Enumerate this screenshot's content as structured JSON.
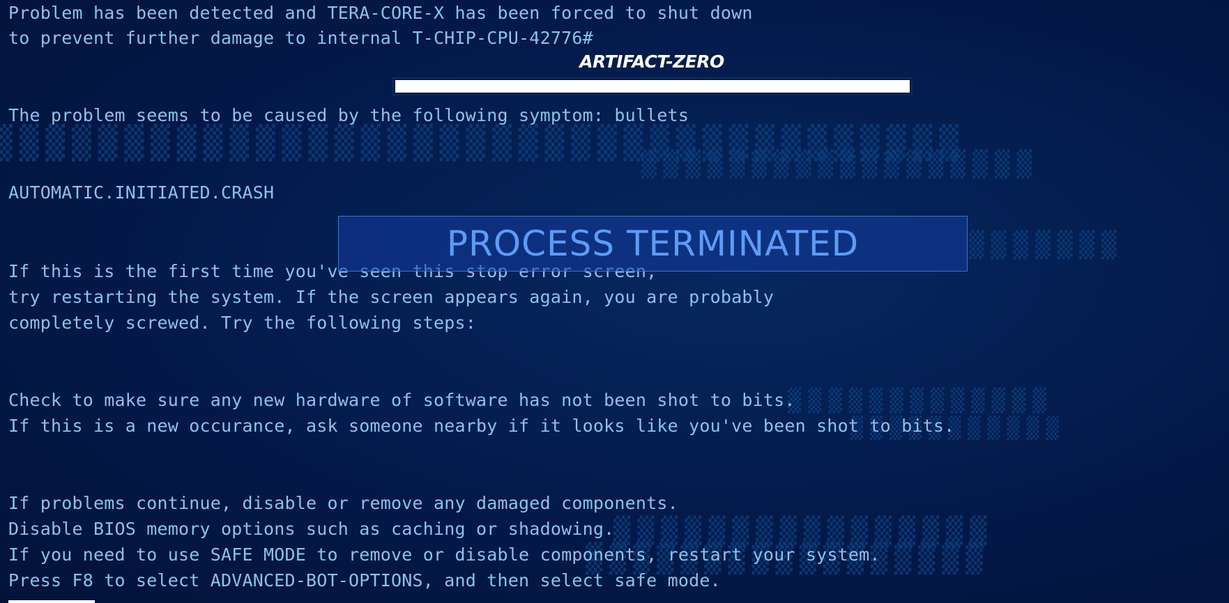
{
  "header": {
    "line1": "Problem has been detected and TERA-CORE-X has been forced to shut down",
    "line2": "to prevent further damage to internal T-CHIP-CPU-42776#"
  },
  "logo": {
    "text": "ARTIFACT-ZERO"
  },
  "progress": {
    "fraction": 1.0
  },
  "symptom": "The problem seems to be caused by the following symptom: bullets",
  "crash_code": "AUTOMATIC.INITIATED.CRASH",
  "overlay": {
    "title": "PROCESS TERMINATED"
  },
  "first_time": {
    "line1": "If this is the first time you've seen this stop error screen,",
    "line2": "try restarting the system. If the screen appears again, you are probably",
    "line3": "completely screwed. Try the following steps:"
  },
  "check": {
    "line1": "Check to make sure any new hardware of software has not been shot to bits.",
    "line2": "If this is a new occurance, ask someone nearby if it looks like you've been shot to bits."
  },
  "continue": {
    "line1": "If problems continue, disable or remove any damaged components.",
    "line2": "Disable BIOS memory options such as caching or shadowing.",
    "line3": "If you need to use SAFE MODE to remove or disable components, restart your system.",
    "line4": "Press F8 to select ADVANCED-BOT-OPTIONS, and then select safe mode."
  },
  "colors": {
    "background": "#021642",
    "text": "#8cc2ea",
    "overlay_text": "#5d9cf5",
    "overlay_border": "#3f6fd6",
    "logo": "#ffffff"
  }
}
